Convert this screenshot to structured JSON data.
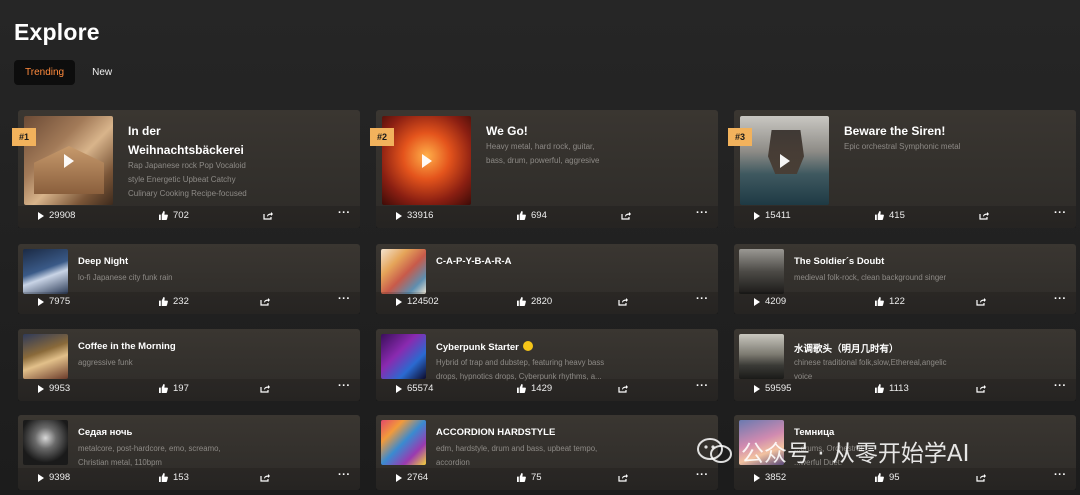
{
  "header": {
    "title": "Explore"
  },
  "tabs": [
    {
      "label": "Trending",
      "active": true
    },
    {
      "label": "New",
      "active": false
    }
  ],
  "featured": [
    {
      "rank": "#1",
      "title_line1": "In der",
      "title_line2": "Weihnachtsbäckerei",
      "desc_lines": [
        "Rap Japanese rock Pop Vocaloid",
        "style Energetic Upbeat Catchy",
        "Culinary Cooking Recipe-focused"
      ],
      "plays": "29908",
      "likes": "702"
    },
    {
      "rank": "#2",
      "title_line1": "We Go!",
      "title_line2": "",
      "desc_lines": [
        "Heavy metal, hard rock, guitar,",
        "bass, drum, powerful, aggresive"
      ],
      "plays": "33916",
      "likes": "694"
    },
    {
      "rank": "#3",
      "title_line1": "Beware the Siren!",
      "title_line2": "",
      "desc_lines": [
        "Epic orchestral Symphonic metal"
      ],
      "plays": "15411",
      "likes": "415"
    }
  ],
  "songs": [
    {
      "title": "Deep Night",
      "desc_lines": [
        "lo-fi Japanese city funk rain"
      ],
      "plays": "7975",
      "likes": "232"
    },
    {
      "title": "C-A-P-Y-B-A-R-A",
      "desc_lines": [],
      "plays": "124502",
      "likes": "2820"
    },
    {
      "title": "The Soldier´s Doubt",
      "desc_lines": [
        "medieval folk-rock, clean background singer"
      ],
      "plays": "4209",
      "likes": "122"
    },
    {
      "title": "Coffee in the Morning",
      "desc_lines": [
        "aggressive funk"
      ],
      "plays": "9953",
      "likes": "197"
    },
    {
      "title": "Cyberpunk Starter",
      "desc_lines": [
        "Hybrid of trap and dubstep, featuring heavy bass",
        "drops, hypnotics drops, Cyberpunk rhythms, a..."
      ],
      "plays": "65574",
      "likes": "1429"
    },
    {
      "title": "水调歌头（明月几时有）",
      "desc_lines": [
        "chinese traditional folk,slow,Ethereal,angelic",
        "voice"
      ],
      "plays": "59595",
      "likes": "1113"
    },
    {
      "title": "Седая ночь",
      "desc_lines": [
        "metalcore, post-hardcore, emo, screamo,",
        "Christian metal, 110bpm"
      ],
      "plays": "9398",
      "likes": "153"
    },
    {
      "title": "ACCORDION HARDSTYLE",
      "desc_lines": [
        "edm, hardstyle, drum and bass, upbeat tempo,",
        "accordion"
      ],
      "plays": "2764",
      "likes": "75"
    },
    {
      "title": "Темница",
      "desc_lines": [
        "...drums, Orchestral ...",
        "...werful Duet."
      ],
      "plays": "3852",
      "likes": "95"
    }
  ],
  "watermark": {
    "text": "公众号 · 从零开始学AI"
  },
  "colors": {
    "accent": "#ff8a3d",
    "rank_badge": "#f2b25c",
    "card": "#34312d",
    "bg": "#222222"
  }
}
